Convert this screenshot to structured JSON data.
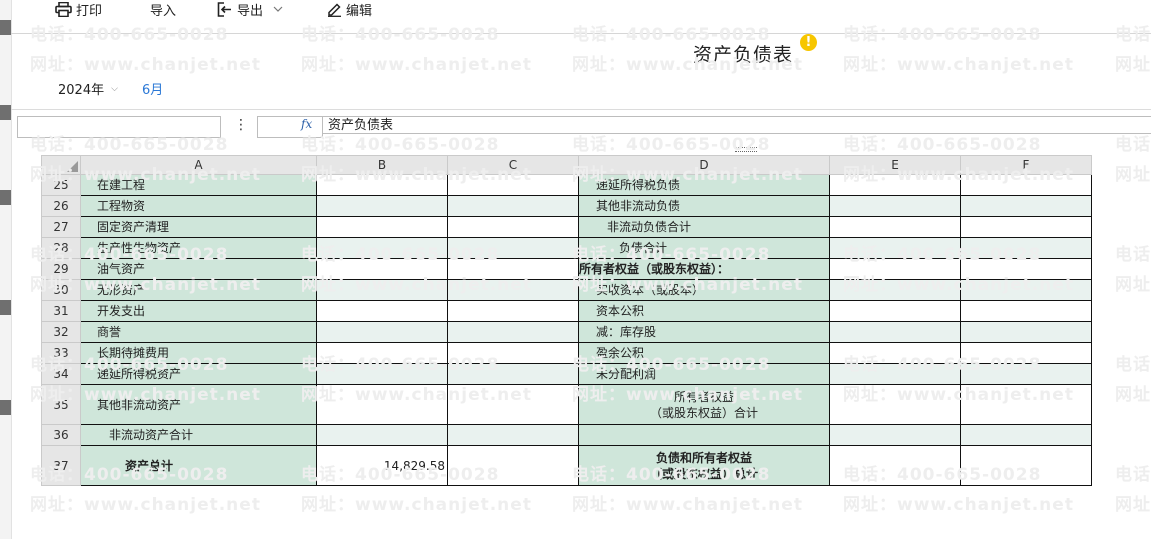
{
  "toolbar": {
    "print": "打印",
    "import": "导入",
    "export": "导出",
    "edit": "编辑"
  },
  "report": {
    "title": "资产负债表",
    "year": "2024年",
    "month": "6月"
  },
  "formula_bar": {
    "name_box": "",
    "cell_ref": "",
    "value": "资产负债表"
  },
  "columns": [
    "A",
    "B",
    "C",
    "D",
    "E",
    "F"
  ],
  "rows": [
    {
      "num": "25",
      "a": "在建工程",
      "b": "",
      "d": "递延所得税负债"
    },
    {
      "num": "26",
      "a": "工程物资",
      "b": "",
      "d": "其他非流动负债"
    },
    {
      "num": "27",
      "a": "固定资产清理",
      "b": "",
      "d": "非流动负债合计"
    },
    {
      "num": "28",
      "a": "生产性生物资产",
      "b": "",
      "d": "负债合计"
    },
    {
      "num": "29",
      "a": "油气资产",
      "b": "",
      "d": "所有者权益（或股东权益）："
    },
    {
      "num": "30",
      "a": "无形资产",
      "b": "",
      "d": "实收资本（或股本）"
    },
    {
      "num": "31",
      "a": "开发支出",
      "b": "",
      "d": "资本公积"
    },
    {
      "num": "32",
      "a": "商誉",
      "b": "",
      "d": "减：库存股"
    },
    {
      "num": "33",
      "a": "长期待摊费用",
      "b": "",
      "d": "盈余公积"
    },
    {
      "num": "34",
      "a": "递延所得税资产",
      "b": "",
      "d": "未分配利润"
    },
    {
      "num": "35",
      "a": "其他非流动资产",
      "b": "",
      "d1": "所有者权益",
      "d2": "（或股东权益）合计"
    },
    {
      "num": "36",
      "a": "非流动资产合计",
      "b": "",
      "d": ""
    },
    {
      "num": "37",
      "a": "资产总计",
      "b": "14,829.58",
      "d1": "负债和所有者权益",
      "d2": "（或股东权益）总计"
    }
  ],
  "watermark": {
    "phone": "电话：400-665-0028",
    "site": "网址：www.chanjet.net",
    "phone_short": "电话",
    "site_short": "网址"
  },
  "colors": {
    "cell_green": "#cfe6da",
    "alt_row": "#e9f2ef",
    "link_blue": "#2b78d6",
    "warning": "#f7c600"
  },
  "icons": [
    "printer-icon",
    "import-icon",
    "export-icon",
    "chevron-down-icon",
    "edit-pencil-icon",
    "warning-icon",
    "fx-icon",
    "more-vertical-icon"
  ]
}
